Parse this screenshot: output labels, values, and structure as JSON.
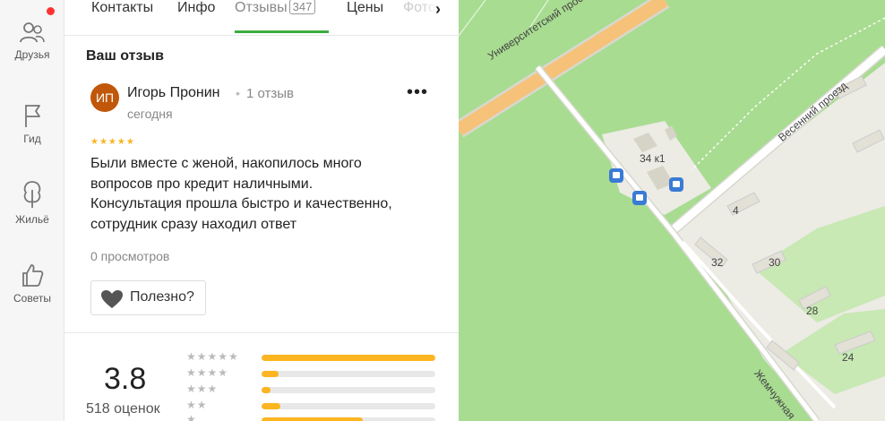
{
  "sidebar": {
    "items": [
      {
        "label": "Друзья",
        "icon": "friends-icon"
      },
      {
        "label": "Гид",
        "icon": "flag-icon"
      },
      {
        "label": "Жильё",
        "icon": "tree-icon"
      },
      {
        "label": "Советы",
        "icon": "thumbs-up-icon"
      }
    ]
  },
  "tabs": {
    "contacts": "Контакты",
    "info": "Инфо",
    "reviews": "Отзывы",
    "reviews_count": "347",
    "prices": "Цены",
    "photos": "Фото",
    "next_icon": "chevron-right-icon"
  },
  "review": {
    "section_title": "Ваш отзыв",
    "avatar_initials": "ИП",
    "avatar_color": "#c0570a",
    "author": "Игорь Пронин",
    "separator": "•",
    "author_reviews": "1 отзыв",
    "date": "сегодня",
    "rating": 5,
    "stars_text": "★★★★★",
    "text_lines": [
      "Были вместе с женой, накопилось много",
      "вопросов про кредит наличными.",
      "Консультация прошла быстро и качественно,",
      "сотрудник сразу находил ответ"
    ],
    "views": "0 просмотров",
    "useful_label": "Полезно?",
    "more_label": "•••"
  },
  "summary": {
    "rating": "3.8",
    "count_label": "518 оценок",
    "distribution": [
      {
        "stars": "★★★★★",
        "fraction": 1.0
      },
      {
        "stars": "★★★★",
        "fraction": 0.1
      },
      {
        "stars": "★★★",
        "fraction": 0.05
      },
      {
        "stars": "★★",
        "fraction": 0.11
      },
      {
        "stars": "★",
        "fraction": 0.58
      }
    ]
  },
  "map": {
    "street_university": "Университетский проспект",
    "street_vesenny": "Весенний проезд",
    "street_zhemchuzhnaya": "Жемчужная",
    "building_34k1": "34 к1",
    "house_4": "4",
    "house_32": "32",
    "house_30": "30",
    "house_28": "28",
    "house_24": "24",
    "colors": {
      "park": "#a8dc91",
      "urban": "#ecebe4",
      "road": "#ffffff",
      "main_road": "#f6c27a"
    }
  },
  "colors": {
    "accent_green": "#3dad3d",
    "star_yellow": "#fcb521",
    "notification": "#ff3333"
  }
}
